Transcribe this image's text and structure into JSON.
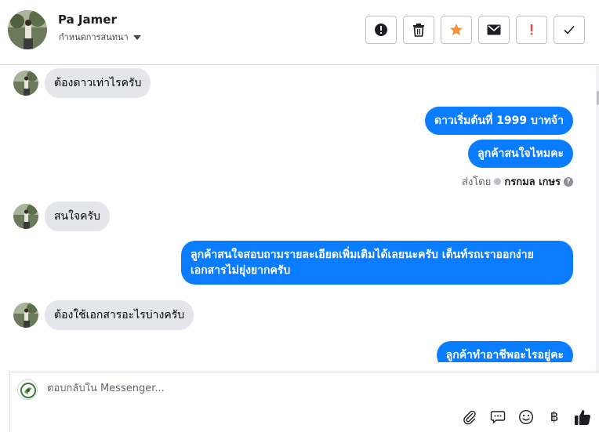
{
  "header": {
    "name": "Pa Jamer",
    "assign_label": "กำหนดการสนทนา"
  },
  "actions": [
    {
      "name": "mark-spam-button",
      "icon": "alert-circle-icon"
    },
    {
      "name": "delete-button",
      "icon": "trash-icon"
    },
    {
      "name": "star-button",
      "icon": "star-icon",
      "color": "#f7923b"
    },
    {
      "name": "mark-unread-button",
      "icon": "envelope-icon"
    },
    {
      "name": "follow-up-button",
      "icon": "exclamation-icon",
      "color": "#fa3e3e"
    },
    {
      "name": "mark-done-button",
      "icon": "check-icon"
    }
  ],
  "messages": [
    {
      "direction": "in",
      "text": "ต้องดาวเท่าไรครับ"
    },
    {
      "direction": "out",
      "text": "ดาวเริ่มต้นที่ 1999 บาทจ้า"
    },
    {
      "direction": "out",
      "text": "ลูกค้าสนใจไหมคะ"
    },
    {
      "direction": "in",
      "text": "สนใจครับ"
    },
    {
      "direction": "out",
      "text": "ลูกค้าสนใจสอบถามรายละเอียดเพิ่มเติมได้เลยนะครับ เต็นท์รถเราออกง่าย เอกสารไม่ยุ่งยากครับ"
    },
    {
      "direction": "in",
      "text": "ต้องใช้เอกสารอะไรบ่างครับ"
    },
    {
      "direction": "out",
      "text": "ลูกค้าทำอาชีพอะไรอยู่คะ"
    }
  ],
  "sent_by": {
    "prefix": "ส่งโดย",
    "agent": "กรกมล เกษร",
    "help": "?"
  },
  "composer": {
    "placeholder": "ตอบกลับใน Messenger..."
  },
  "tools": {
    "currency_symbol": "฿"
  },
  "colors": {
    "outgoing_bubble": "#0a7cff",
    "incoming_bubble": "#e4e6eb",
    "like": "#1c1e21"
  }
}
